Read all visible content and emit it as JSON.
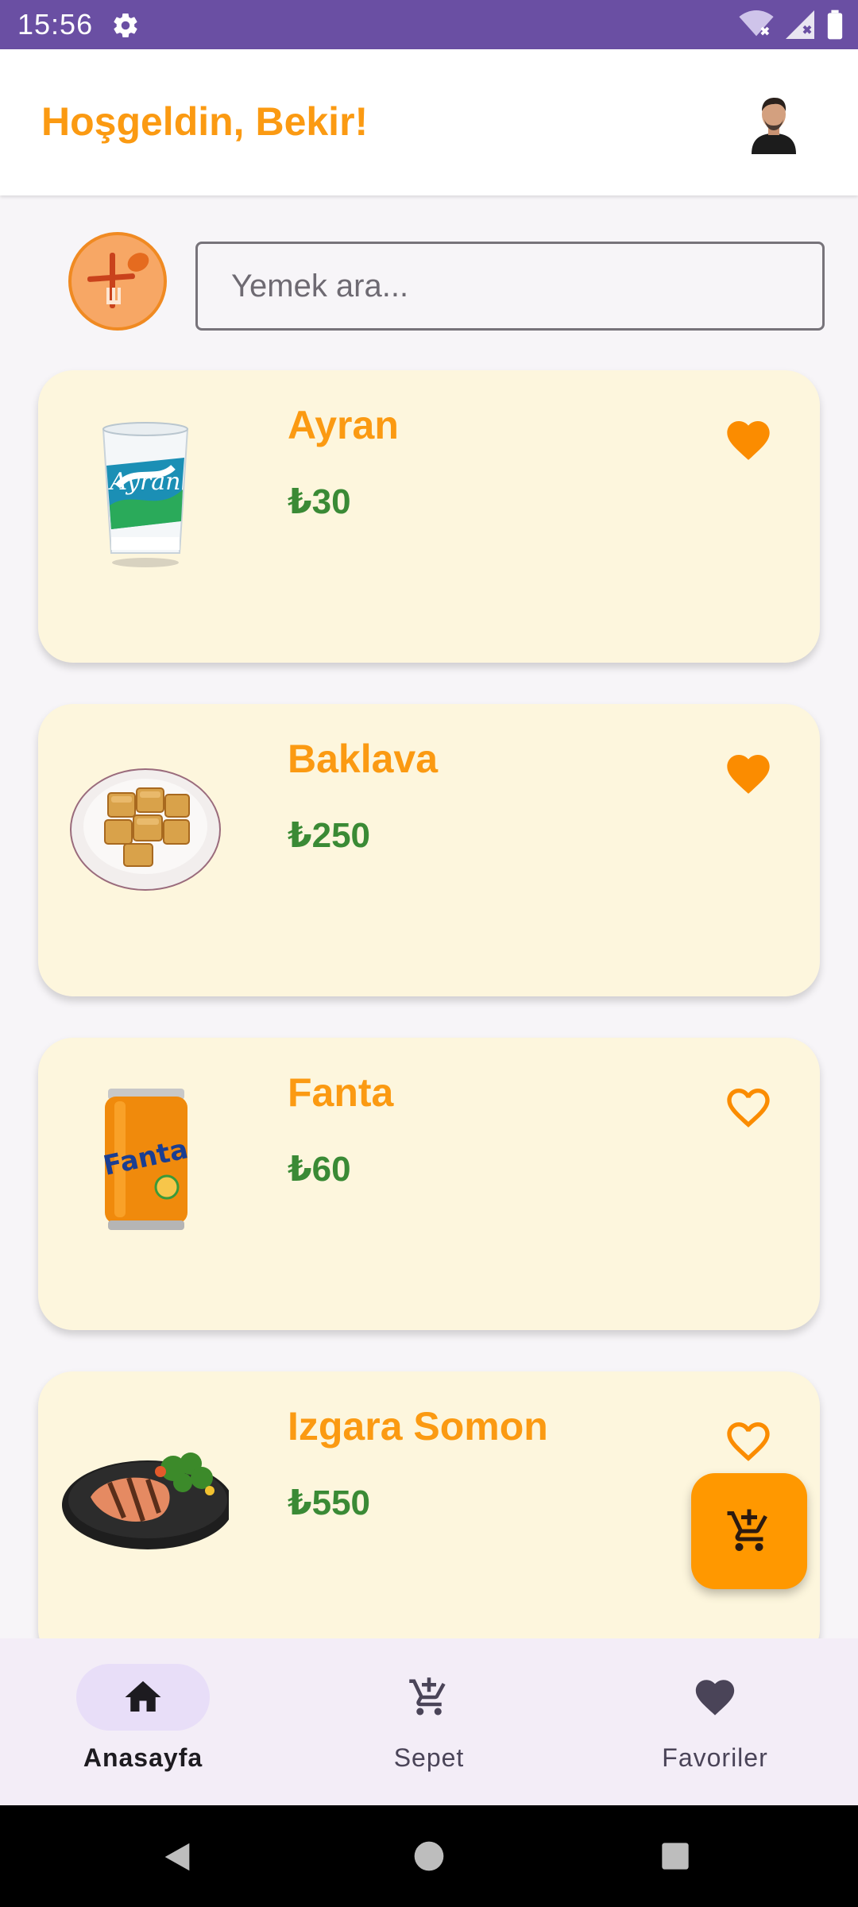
{
  "status_bar": {
    "time": "15:56"
  },
  "header": {
    "greeting": "Hoşgeldin, Bekir!"
  },
  "search": {
    "placeholder": "Yemek ara..."
  },
  "products": [
    {
      "name": "Ayran",
      "price": "₺30",
      "favorite": true,
      "image": "ayran-cup"
    },
    {
      "name": "Baklava",
      "price": "₺250",
      "favorite": true,
      "image": "baklava-plate"
    },
    {
      "name": "Fanta",
      "price": "₺60",
      "favorite": false,
      "image": "fanta-can"
    },
    {
      "name": "Izgara Somon",
      "price": "₺550",
      "favorite": false,
      "image": "grilled-salmon"
    }
  ],
  "bottom_nav": {
    "items": [
      {
        "label": "Anasayfa",
        "icon": "home-icon",
        "active": true
      },
      {
        "label": "Sepet",
        "icon": "add-cart-icon",
        "active": false
      },
      {
        "label": "Favoriler",
        "icon": "heart-icon",
        "active": false
      }
    ]
  },
  "colors": {
    "accent": "#fb9a12",
    "price": "#3a8a35",
    "card_bg": "#fdf6dd",
    "status_bar": "#6a4fa3"
  }
}
